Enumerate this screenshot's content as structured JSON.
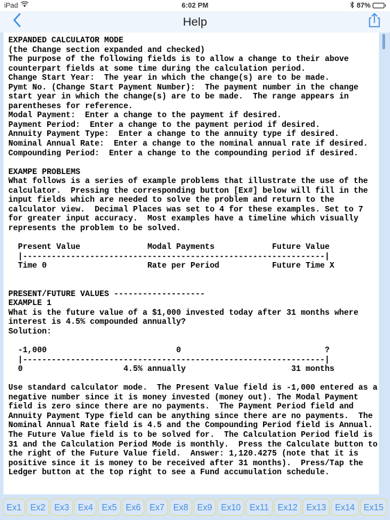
{
  "status_bar": {
    "device": "iPad",
    "wifi_icon": "wifi-icon",
    "time": "6:02 PM",
    "bluetooth_icon": "bluetooth-icon",
    "battery_percent": "87%",
    "battery_icon": "battery-icon"
  },
  "nav_bar": {
    "back_icon": "chevron-left-icon",
    "title": "Help",
    "share_icon": "share-icon"
  },
  "help": {
    "body": "EXPANDED CALCULATOR MODE\n(the Change section expanded and checked)\nThe purpose of the following fields is to allow a change to their above\ncounterpart fields at some time during the calculation period.\nChange Start Year:  The year in which the change(s) are to be made.\nPymt No. (Change Start Payment Number):  The payment number in the change\nstart year in which the change(s) are to be made.  The range appears in\nparentheses for reference.\nModal Payment:  Enter a change to the payment if desired.\nPayment Period:  Enter a change to the payment period if desired.\nAnnuity Payment Type:  Enter a change to the annuity type if desired.\nNominal Annual Rate:  Enter a change to the nominal annual rate if desired.\nCompounding Period:  Enter a change to the compounding period if desired.\n\nEXAMPE PROBLEMS\nWhat follows is a series of example problems that illustrate the use of the\ncalculator.  Pressing the corresponding button [Ex#] below will fill in the\ninput fields which are needed to solve the problem and return to the\ncalculator view.  Decimal Places was set to 4 for these examples. Set to 7\nfor greater input accuracy.  Most examples have a timeline which visually\nrepresents the problem to be solved.\n\n  Present Value              Modal Payments            Future Value\n  |---------------------------------------------------------------|\n  Time 0                     Rate per Period           Future Time X\n\n\nPRESENT/FUTURE VALUES -------------------\nEXAMPLE 1\nWhat is the future value of a $1,000 invested today after 31 months where\ninterest is 4.5% compounded annually?\nSolution:\n\n  -1,000                           0                              ?\n  |---------------------------------------------------------------|\n  0                     4.5% annually                      31 months\n\nUse standard calculator mode.  The Present Value field is -1,000 entered as a\nnegative number since it is money invested (money out). The Modal Payment\nfield is zero since there are no payments.  The Payment Period field and\nAnnuity Payment Type field can be anything since there are no payments.  The\nNominal Annual Rate field is 4.5 and the Compounding Period field is Annual.\nThe Future Value field is to be solved for.  The Calculation Period field is\n31 and the Calculation Period Mode is monthly.  Press the Calculate button to\nthe right of the Future Value field.  Answer: 1,120.4275 (note that it is\npositive since it is money to be received after 31 months).  Press/Tap the\nLedger button at the top right to see a Fund accumulation schedule.\n",
    "scroll_indicator": "scroll-thumb"
  },
  "example_bar": {
    "buttons": [
      {
        "label": "Ex1"
      },
      {
        "label": "Ex2"
      },
      {
        "label": "Ex3"
      },
      {
        "label": "Ex4"
      },
      {
        "label": "Ex5"
      },
      {
        "label": "Ex6"
      },
      {
        "label": "Ex7"
      },
      {
        "label": "Ex8"
      },
      {
        "label": "Ex9"
      },
      {
        "label": "Ex10"
      },
      {
        "label": "Ex11"
      },
      {
        "label": "Ex12"
      },
      {
        "label": "Ex13"
      },
      {
        "label": "Ex14"
      },
      {
        "label": "Ex15"
      }
    ]
  },
  "colors": {
    "nav_bar_bg": "#eff5fc",
    "content_bg": "#d4e4f7",
    "text_bg": "#ffffff",
    "accent_blue": "#4a90d9",
    "button_border": "#e3d88d",
    "scroll_thumb": "#7ba7d4"
  }
}
